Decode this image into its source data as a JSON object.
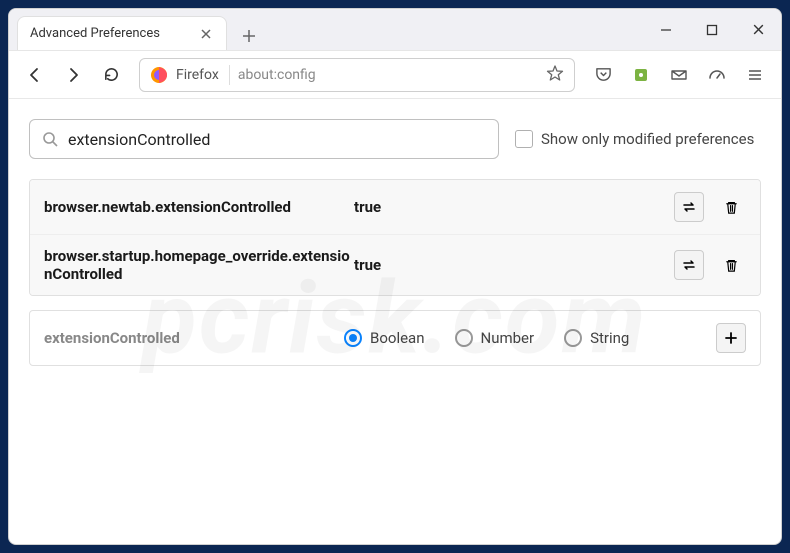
{
  "tab": {
    "title": "Advanced Preferences"
  },
  "urlbar": {
    "identity": "Firefox",
    "url": "about:config"
  },
  "search": {
    "value": "extensionControlled",
    "show_modified_label": "Show only modified preferences"
  },
  "prefs": [
    {
      "name": "browser.newtab.extensionControlled",
      "value": "true"
    },
    {
      "name": "browser.startup.homepage_override.extensionControlled",
      "value": "true"
    }
  ],
  "add_row": {
    "name": "extensionControlled",
    "types": {
      "boolean": "Boolean",
      "number": "Number",
      "string": "String"
    },
    "selected": "boolean"
  },
  "watermark": "pcrisk.com"
}
